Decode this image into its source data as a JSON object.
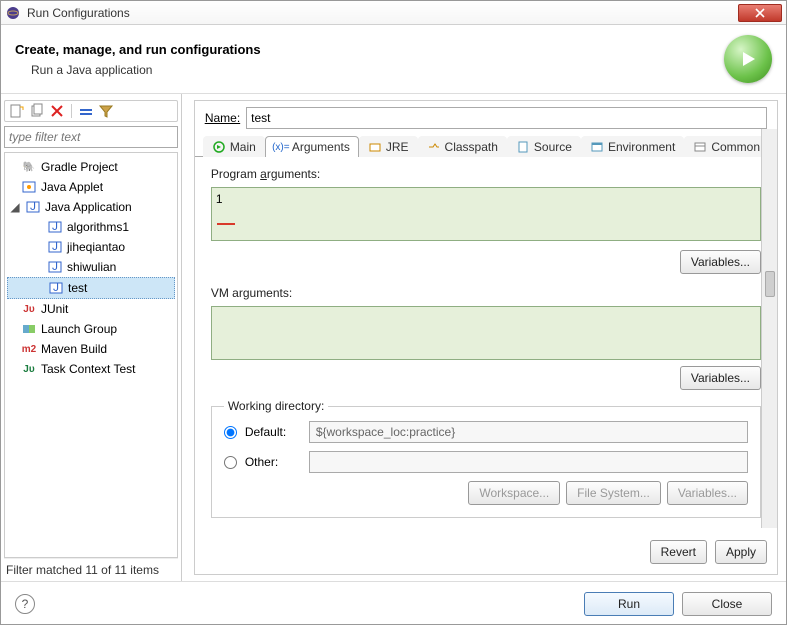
{
  "window": {
    "title": "Run Configurations"
  },
  "header": {
    "title": "Create, manage, and run configurations",
    "subtitle": "Run a Java application"
  },
  "left": {
    "filter_placeholder": "type filter text",
    "tree": [
      {
        "label": "Gradle Project",
        "kind": "gradle"
      },
      {
        "label": "Java Applet",
        "kind": "applet"
      },
      {
        "label": "Java Application",
        "kind": "java",
        "expanded": true,
        "children": [
          {
            "label": "algorithms1"
          },
          {
            "label": "jiheqiantao"
          },
          {
            "label": "shiwulian"
          },
          {
            "label": "test",
            "selected": true
          }
        ]
      },
      {
        "label": "JUnit",
        "kind": "junit"
      },
      {
        "label": "Launch Group",
        "kind": "launchgrp"
      },
      {
        "label": "Maven Build",
        "kind": "maven"
      },
      {
        "label": "Task Context Test",
        "kind": "task"
      }
    ],
    "status": "Filter matched 11 of 11 items"
  },
  "right": {
    "name_label": "Name:",
    "name_value": "test",
    "tabs": [
      {
        "label": "Main"
      },
      {
        "label": "Arguments",
        "active": true
      },
      {
        "label": "JRE"
      },
      {
        "label": "Classpath"
      },
      {
        "label": "Source"
      },
      {
        "label": "Environment"
      },
      {
        "label": "Common"
      }
    ],
    "args": {
      "program_label": "Program arguments:",
      "program_value": "1",
      "vm_label": "VM arguments:",
      "vm_value": "",
      "variables_btn": "Variables..."
    },
    "wd": {
      "group_label": "Working directory:",
      "default_label": "Default:",
      "default_value": "${workspace_loc:practice}",
      "other_label": "Other:",
      "workspace_btn": "Workspace...",
      "filesystem_btn": "File System...",
      "variables_btn": "Variables..."
    },
    "revert_btn": "Revert",
    "apply_btn": "Apply"
  },
  "bottom": {
    "run_btn": "Run",
    "close_btn": "Close"
  }
}
